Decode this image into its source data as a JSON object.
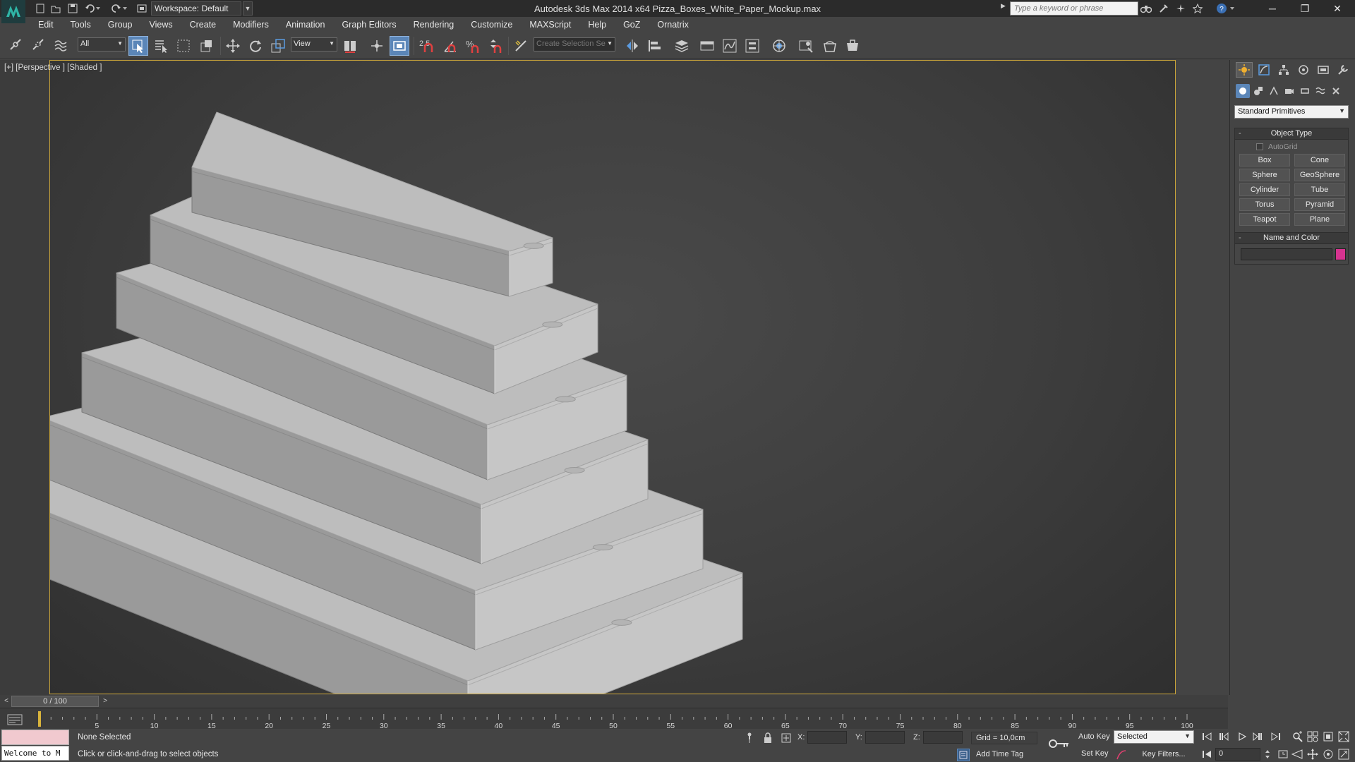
{
  "window": {
    "title": "Autodesk 3ds Max  2014 x64      Pizza_Boxes_White_Paper_Mockup.max",
    "workspace_label": "Workspace: Default",
    "search_placeholder": "Type a keyword or phrase",
    "minimize": "─",
    "maximize": "❐",
    "close": "✕"
  },
  "menu": [
    "Edit",
    "Tools",
    "Group",
    "Views",
    "Create",
    "Modifiers",
    "Animation",
    "Graph Editors",
    "Rendering",
    "Customize",
    "MAXScript",
    "Help",
    "GoZ",
    "Ornatrix"
  ],
  "toolbar": {
    "selection_filter": "All",
    "reference_coord": "View",
    "snap_angle_label": "2.5",
    "named_selection_placeholder": "Create Selection Se"
  },
  "viewport": {
    "label": "[+] [Perspective ] [Shaded ]"
  },
  "command_panel": {
    "category": "Standard Primitives",
    "object_type_title": "Object Type",
    "autogrid_label": "AutoGrid",
    "primitives": [
      "Box",
      "Cone",
      "Sphere",
      "GeoSphere",
      "Cylinder",
      "Tube",
      "Torus",
      "Pyramid",
      "Teapot",
      "Plane"
    ],
    "name_color_title": "Name and Color",
    "object_color": "#d6338f"
  },
  "timeline": {
    "frame_display": "0 / 100",
    "ticks": [
      "5",
      "10",
      "15",
      "20",
      "25",
      "30",
      "35",
      "40",
      "45",
      "50",
      "55",
      "60",
      "65",
      "70",
      "75",
      "80",
      "85",
      "90",
      "95",
      "100"
    ]
  },
  "status": {
    "maxscript_text": "Welcome to M",
    "selection_status": "None Selected",
    "prompt": "Click or click-and-drag to select objects",
    "x_label": "X:",
    "y_label": "Y:",
    "z_label": "Z:",
    "grid": "Grid = 10,0cm",
    "add_time_tag": "Add Time Tag",
    "auto_key": "Auto Key",
    "set_key": "Set Key",
    "key_mode": "Selected",
    "key_filters": "Key Filters...",
    "current_frame": "0"
  },
  "colors": {
    "accent_active": "#5b86b8",
    "viewport_border": "#c9a43a"
  }
}
